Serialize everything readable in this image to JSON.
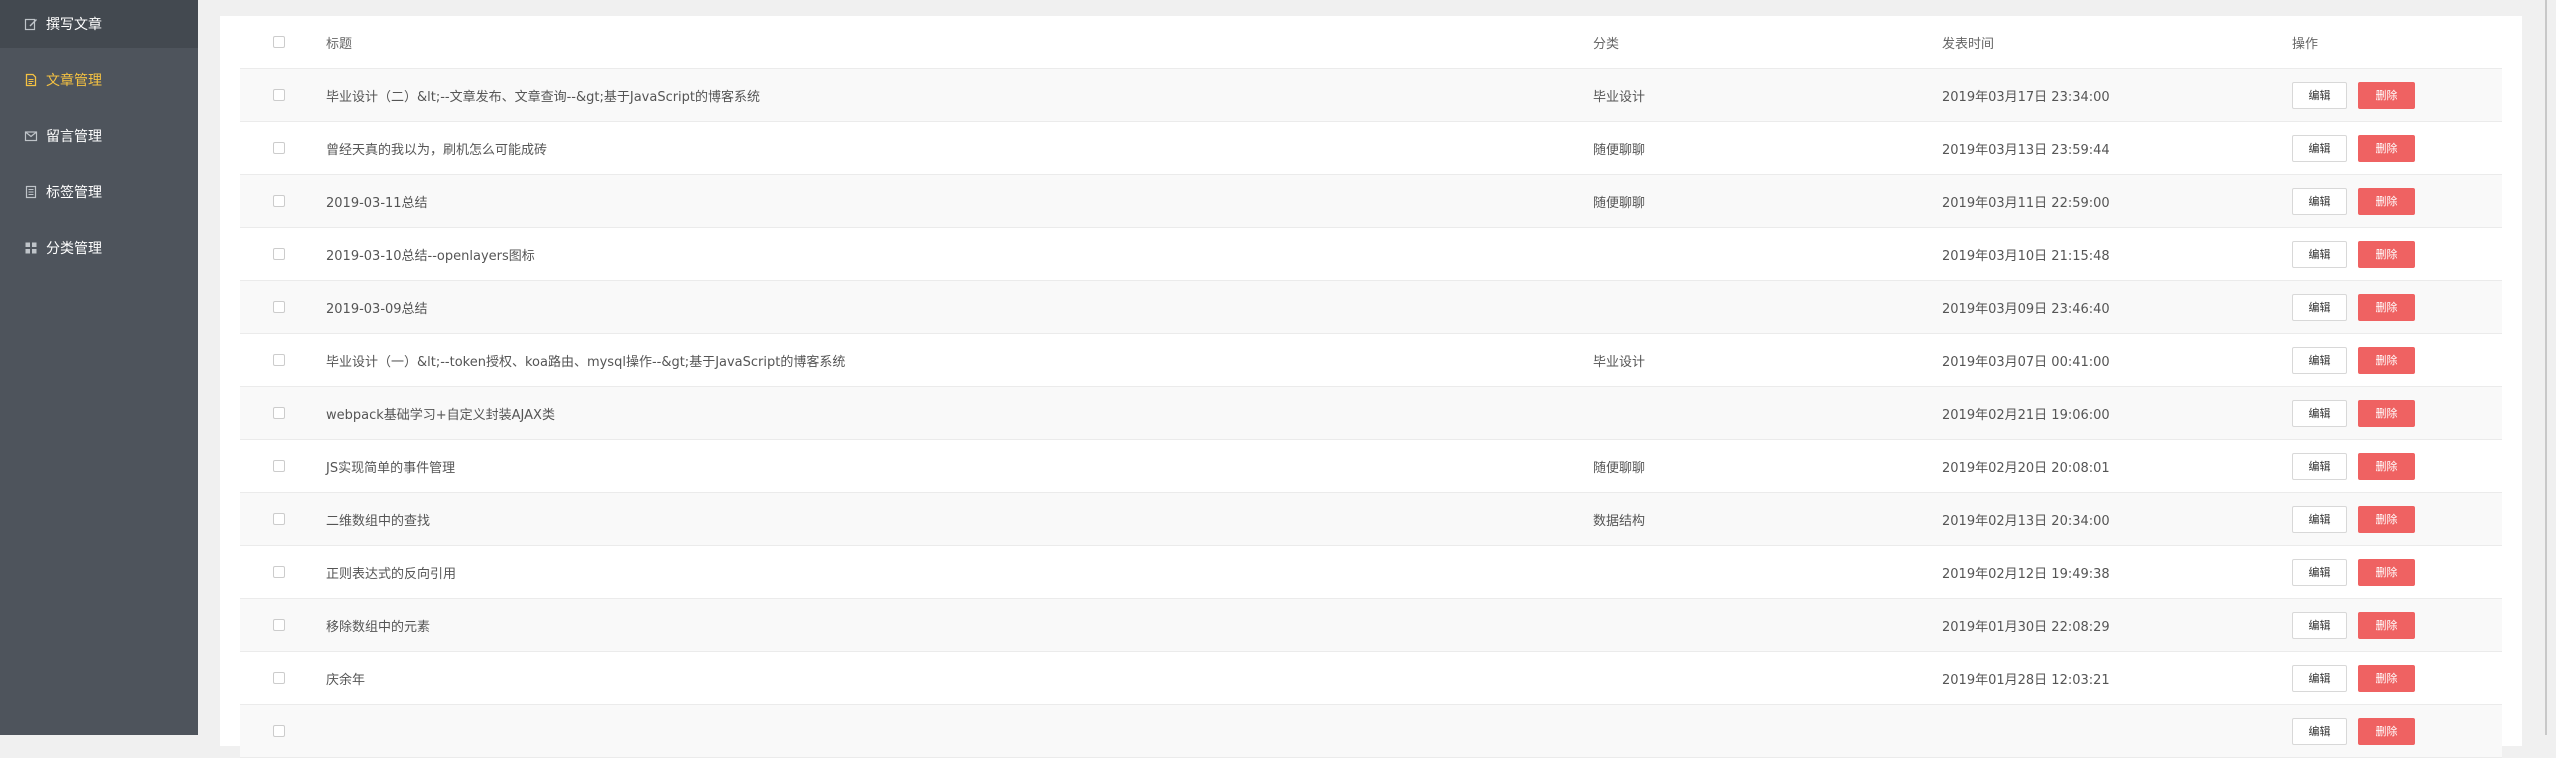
{
  "sidebar": {
    "items": [
      {
        "label": "撰写文章",
        "icon": "edit-icon"
      },
      {
        "label": "文章管理",
        "icon": "document-icon"
      },
      {
        "label": "留言管理",
        "icon": "envelope-icon"
      },
      {
        "label": "标签管理",
        "icon": "tag-list-icon"
      },
      {
        "label": "分类管理",
        "icon": "grid-icon"
      }
    ],
    "active_color": "#f5c242"
  },
  "table": {
    "headers": {
      "title": "标题",
      "category": "分类",
      "time": "发表时间",
      "ops": "操作"
    },
    "edit_label": "编辑",
    "delete_label": "删除",
    "rows": [
      {
        "title": "毕业设计（二）&lt;--文章发布、文章查询--&gt;基于JavaScript的博客系统",
        "category": "毕业设计",
        "time": "2019年03月17日 23:34:00"
      },
      {
        "title": "曾经天真的我以为，刷机怎么可能成砖",
        "category": "随便聊聊",
        "time": "2019年03月13日 23:59:44"
      },
      {
        "title": "2019-03-11总结",
        "category": "随便聊聊",
        "time": "2019年03月11日 22:59:00"
      },
      {
        "title": "2019-03-10总结--openlayers图标",
        "category": "",
        "time": "2019年03月10日 21:15:48"
      },
      {
        "title": "2019-03-09总结",
        "category": "",
        "time": "2019年03月09日 23:46:40"
      },
      {
        "title": "毕业设计（一）&lt;--token授权、koa路由、mysql操作--&gt;基于JavaScript的博客系统",
        "category": "毕业设计",
        "time": "2019年03月07日 00:41:00"
      },
      {
        "title": "webpack基础学习+自定义封装AJAX类",
        "category": "",
        "time": "2019年02月21日 19:06:00"
      },
      {
        "title": "JS实现简单的事件管理",
        "category": "随便聊聊",
        "time": "2019年02月20日 20:08:01"
      },
      {
        "title": "二维数组中的查找",
        "category": "数据结构",
        "time": "2019年02月13日 20:34:00"
      },
      {
        "title": "正则表达式的反向引用",
        "category": "",
        "time": "2019年02月12日 19:49:38"
      },
      {
        "title": "移除数组中的元素",
        "category": "",
        "time": "2019年01月30日 22:08:29"
      },
      {
        "title": "庆余年",
        "category": "",
        "time": "2019年01月28日 12:03:21"
      },
      {
        "title": "",
        "category": "",
        "time": ""
      }
    ]
  },
  "colors": {
    "delete_button": "#ef6262",
    "sidebar_bg": "#4e545c"
  }
}
